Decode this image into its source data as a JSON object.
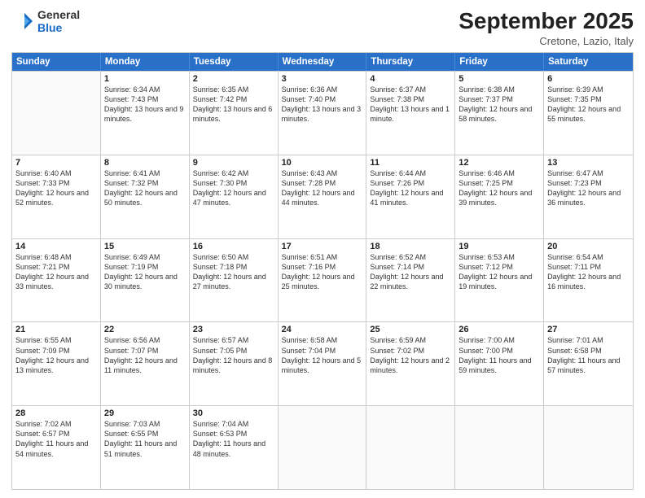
{
  "header": {
    "logo_line1": "General",
    "logo_line2": "Blue",
    "month_year": "September 2025",
    "location": "Cretone, Lazio, Italy"
  },
  "days_of_week": [
    "Sunday",
    "Monday",
    "Tuesday",
    "Wednesday",
    "Thursday",
    "Friday",
    "Saturday"
  ],
  "weeks": [
    [
      {
        "day": "",
        "empty": true
      },
      {
        "day": "1",
        "sunrise": "Sunrise: 6:34 AM",
        "sunset": "Sunset: 7:43 PM",
        "daylight": "Daylight: 13 hours and 9 minutes."
      },
      {
        "day": "2",
        "sunrise": "Sunrise: 6:35 AM",
        "sunset": "Sunset: 7:42 PM",
        "daylight": "Daylight: 13 hours and 6 minutes."
      },
      {
        "day": "3",
        "sunrise": "Sunrise: 6:36 AM",
        "sunset": "Sunset: 7:40 PM",
        "daylight": "Daylight: 13 hours and 3 minutes."
      },
      {
        "day": "4",
        "sunrise": "Sunrise: 6:37 AM",
        "sunset": "Sunset: 7:38 PM",
        "daylight": "Daylight: 13 hours and 1 minute."
      },
      {
        "day": "5",
        "sunrise": "Sunrise: 6:38 AM",
        "sunset": "Sunset: 7:37 PM",
        "daylight": "Daylight: 12 hours and 58 minutes."
      },
      {
        "day": "6",
        "sunrise": "Sunrise: 6:39 AM",
        "sunset": "Sunset: 7:35 PM",
        "daylight": "Daylight: 12 hours and 55 minutes."
      }
    ],
    [
      {
        "day": "7",
        "sunrise": "Sunrise: 6:40 AM",
        "sunset": "Sunset: 7:33 PM",
        "daylight": "Daylight: 12 hours and 52 minutes."
      },
      {
        "day": "8",
        "sunrise": "Sunrise: 6:41 AM",
        "sunset": "Sunset: 7:32 PM",
        "daylight": "Daylight: 12 hours and 50 minutes."
      },
      {
        "day": "9",
        "sunrise": "Sunrise: 6:42 AM",
        "sunset": "Sunset: 7:30 PM",
        "daylight": "Daylight: 12 hours and 47 minutes."
      },
      {
        "day": "10",
        "sunrise": "Sunrise: 6:43 AM",
        "sunset": "Sunset: 7:28 PM",
        "daylight": "Daylight: 12 hours and 44 minutes."
      },
      {
        "day": "11",
        "sunrise": "Sunrise: 6:44 AM",
        "sunset": "Sunset: 7:26 PM",
        "daylight": "Daylight: 12 hours and 41 minutes."
      },
      {
        "day": "12",
        "sunrise": "Sunrise: 6:46 AM",
        "sunset": "Sunset: 7:25 PM",
        "daylight": "Daylight: 12 hours and 39 minutes."
      },
      {
        "day": "13",
        "sunrise": "Sunrise: 6:47 AM",
        "sunset": "Sunset: 7:23 PM",
        "daylight": "Daylight: 12 hours and 36 minutes."
      }
    ],
    [
      {
        "day": "14",
        "sunrise": "Sunrise: 6:48 AM",
        "sunset": "Sunset: 7:21 PM",
        "daylight": "Daylight: 12 hours and 33 minutes."
      },
      {
        "day": "15",
        "sunrise": "Sunrise: 6:49 AM",
        "sunset": "Sunset: 7:19 PM",
        "daylight": "Daylight: 12 hours and 30 minutes."
      },
      {
        "day": "16",
        "sunrise": "Sunrise: 6:50 AM",
        "sunset": "Sunset: 7:18 PM",
        "daylight": "Daylight: 12 hours and 27 minutes."
      },
      {
        "day": "17",
        "sunrise": "Sunrise: 6:51 AM",
        "sunset": "Sunset: 7:16 PM",
        "daylight": "Daylight: 12 hours and 25 minutes."
      },
      {
        "day": "18",
        "sunrise": "Sunrise: 6:52 AM",
        "sunset": "Sunset: 7:14 PM",
        "daylight": "Daylight: 12 hours and 22 minutes."
      },
      {
        "day": "19",
        "sunrise": "Sunrise: 6:53 AM",
        "sunset": "Sunset: 7:12 PM",
        "daylight": "Daylight: 12 hours and 19 minutes."
      },
      {
        "day": "20",
        "sunrise": "Sunrise: 6:54 AM",
        "sunset": "Sunset: 7:11 PM",
        "daylight": "Daylight: 12 hours and 16 minutes."
      }
    ],
    [
      {
        "day": "21",
        "sunrise": "Sunrise: 6:55 AM",
        "sunset": "Sunset: 7:09 PM",
        "daylight": "Daylight: 12 hours and 13 minutes."
      },
      {
        "day": "22",
        "sunrise": "Sunrise: 6:56 AM",
        "sunset": "Sunset: 7:07 PM",
        "daylight": "Daylight: 12 hours and 11 minutes."
      },
      {
        "day": "23",
        "sunrise": "Sunrise: 6:57 AM",
        "sunset": "Sunset: 7:05 PM",
        "daylight": "Daylight: 12 hours and 8 minutes."
      },
      {
        "day": "24",
        "sunrise": "Sunrise: 6:58 AM",
        "sunset": "Sunset: 7:04 PM",
        "daylight": "Daylight: 12 hours and 5 minutes."
      },
      {
        "day": "25",
        "sunrise": "Sunrise: 6:59 AM",
        "sunset": "Sunset: 7:02 PM",
        "daylight": "Daylight: 12 hours and 2 minutes."
      },
      {
        "day": "26",
        "sunrise": "Sunrise: 7:00 AM",
        "sunset": "Sunset: 7:00 PM",
        "daylight": "Daylight: 11 hours and 59 minutes."
      },
      {
        "day": "27",
        "sunrise": "Sunrise: 7:01 AM",
        "sunset": "Sunset: 6:58 PM",
        "daylight": "Daylight: 11 hours and 57 minutes."
      }
    ],
    [
      {
        "day": "28",
        "sunrise": "Sunrise: 7:02 AM",
        "sunset": "Sunset: 6:57 PM",
        "daylight": "Daylight: 11 hours and 54 minutes."
      },
      {
        "day": "29",
        "sunrise": "Sunrise: 7:03 AM",
        "sunset": "Sunset: 6:55 PM",
        "daylight": "Daylight: 11 hours and 51 minutes."
      },
      {
        "day": "30",
        "sunrise": "Sunrise: 7:04 AM",
        "sunset": "Sunset: 6:53 PM",
        "daylight": "Daylight: 11 hours and 48 minutes."
      },
      {
        "day": "",
        "empty": true
      },
      {
        "day": "",
        "empty": true
      },
      {
        "day": "",
        "empty": true
      },
      {
        "day": "",
        "empty": true
      }
    ]
  ]
}
